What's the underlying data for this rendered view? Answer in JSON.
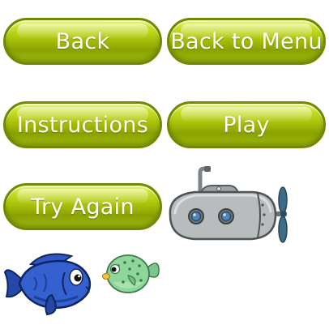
{
  "buttons": {
    "back": "Back",
    "back_to_menu": "Back to Menu",
    "instructions": "Instructions",
    "play": "Play",
    "try_again": "Try Again"
  },
  "sprites": {
    "submarine": "submarine-icon",
    "blue_fish": "blue-fish-icon",
    "puffer_fish": "puffer-fish-icon"
  },
  "colors": {
    "button_fill": "#a8c20a",
    "button_border": "#6f8a00",
    "button_text": "#ffffff",
    "submarine_body": "#b9bcbd",
    "fish_blue": "#2f57c6",
    "puffer_green": "#8ed69a"
  }
}
